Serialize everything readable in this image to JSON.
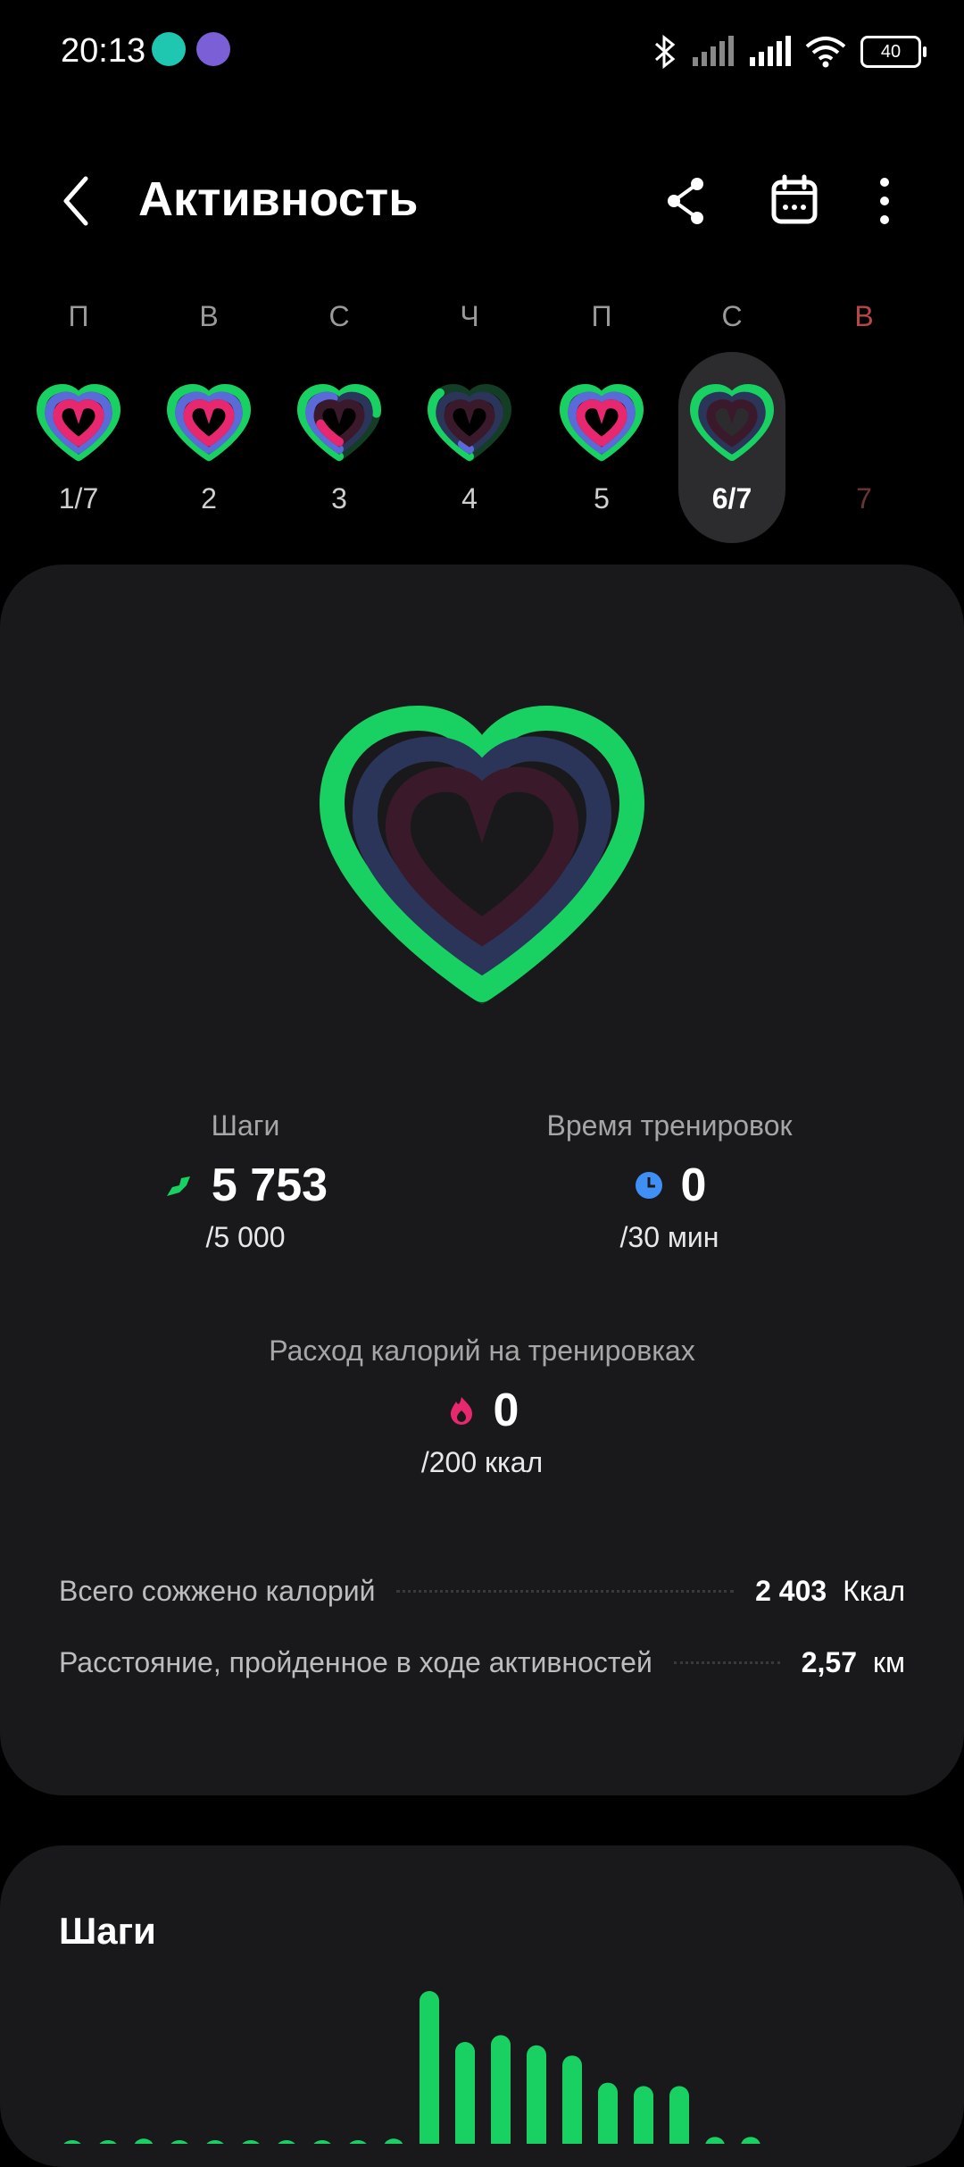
{
  "status_bar": {
    "time": "20:13",
    "battery": "40"
  },
  "header": {
    "title": "Активность"
  },
  "week": [
    {
      "label": "П",
      "day": "1/7",
      "rings": [
        1.0,
        1.0,
        1.0
      ]
    },
    {
      "label": "В",
      "day": "2",
      "rings": [
        1.0,
        1.0,
        1.0
      ]
    },
    {
      "label": "С",
      "day": "3",
      "rings": [
        0.75,
        0.45,
        0.2
      ]
    },
    {
      "label": "Ч",
      "day": "4",
      "rings": [
        0.35,
        0.05,
        0.0
      ]
    },
    {
      "label": "П",
      "day": "5",
      "rings": [
        1.0,
        1.0,
        1.0
      ]
    },
    {
      "label": "С",
      "day": "6/7",
      "rings": [
        1.0,
        0.0,
        0.0
      ],
      "selected": true
    },
    {
      "label": "В",
      "day": "7",
      "rings": null,
      "sunday": true
    }
  ],
  "activity": {
    "steps": {
      "caption": "Шаги",
      "value": "5 753",
      "goal": "/5 000"
    },
    "workout_time": {
      "caption": "Время тренировок",
      "value": "0",
      "goal": "/30 мин"
    },
    "workout_calories": {
      "caption": "Расход калорий на тренировках",
      "value": "0",
      "goal": "/200 ккал"
    },
    "total_calories": {
      "label": "Всего сожжено калорий",
      "value": "2 403",
      "unit": "Ккал"
    },
    "distance": {
      "label": "Расстояние, пройденное в ходе активностей",
      "value": "2,57",
      "unit": "км"
    }
  },
  "steps_card": {
    "title": "Шаги"
  },
  "chart_data": {
    "type": "bar",
    "values": [
      0,
      0,
      3,
      0,
      0,
      2,
      0,
      0,
      2,
      3,
      90,
      60,
      64,
      58,
      52,
      36,
      34,
      34,
      4,
      4
    ],
    "ylim": [
      0,
      100
    ]
  },
  "colors": {
    "green": "#19d162",
    "blue": "#5a6bd9",
    "pink": "#e8286e",
    "dark_track": "#2b3459",
    "accent_sunday": "#b94646"
  }
}
